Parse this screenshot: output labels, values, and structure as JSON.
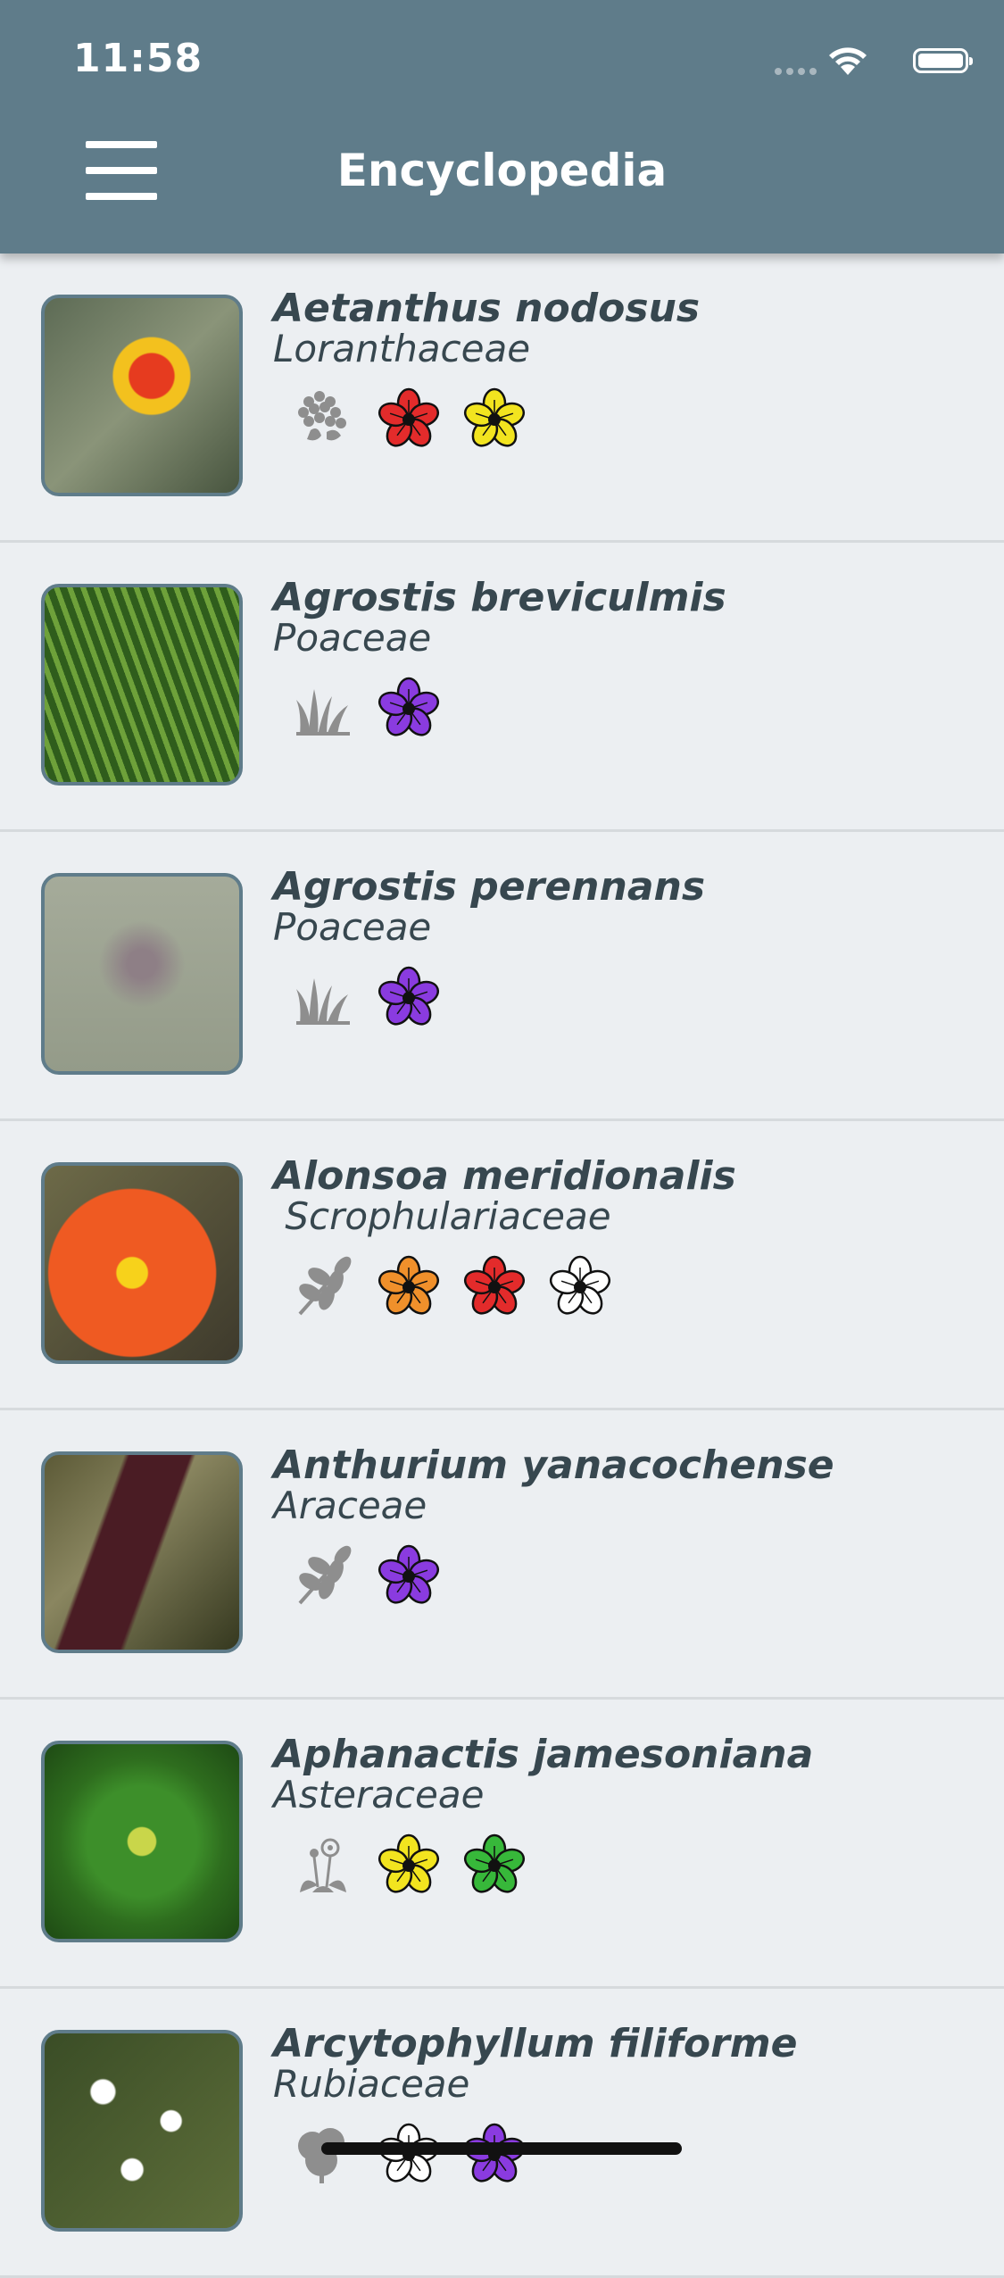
{
  "status_bar": {
    "time": "11:58"
  },
  "header": {
    "title": "Encyclopedia"
  },
  "colors": {
    "header_bg": "#5f7c8a",
    "text": "#37474f",
    "red": "#e32b2b",
    "yellow": "#f2e41f",
    "purple": "#8a3be0",
    "orange": "#f0902b",
    "white": "#ffffff",
    "green": "#37b83a"
  },
  "plants": [
    {
      "name": "Aetanthus nodosus",
      "family": "Loranthaceae",
      "image": "plant-photo-aetanthus",
      "growth_icon": "hydrangea-cluster-icon",
      "flowers": [
        "red",
        "yellow"
      ]
    },
    {
      "name": "Agrostis breviculmis",
      "family": "Poaceae",
      "image": "plant-photo-agrostis-breviculmis",
      "growth_icon": "grass-icon",
      "flowers": [
        "purple"
      ]
    },
    {
      "name": "Agrostis perennans",
      "family": "Poaceae",
      "image": "plant-photo-agrostis-perennans",
      "growth_icon": "grass-icon",
      "flowers": [
        "purple"
      ]
    },
    {
      "name": "Alonsoa meridionalis",
      "family": " Scrophulariaceae",
      "image": "plant-photo-alonsoa",
      "growth_icon": "leaf-branch-icon",
      "flowers": [
        "orange",
        "red",
        "white"
      ]
    },
    {
      "name": "Anthurium yanacochense",
      "family": "Araceae",
      "image": "plant-photo-anthurium",
      "growth_icon": "leaf-branch-icon",
      "flowers": [
        "purple"
      ]
    },
    {
      "name": "Aphanactis jamesoniana",
      "family": "Asteraceae",
      "image": "plant-photo-aphanactis",
      "growth_icon": "rosette-flower-icon",
      "flowers": [
        "yellow",
        "green"
      ]
    },
    {
      "name": "Arcytophyllum filiforme",
      "family": "Rubiaceae",
      "image": "plant-photo-arcytophyllum",
      "growth_icon": "shrub-icon",
      "flowers": [
        "white",
        "purple"
      ]
    }
  ]
}
